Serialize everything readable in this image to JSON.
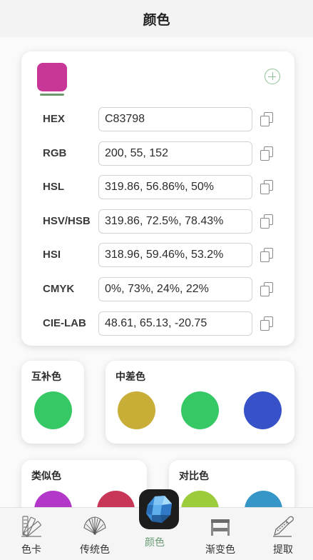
{
  "header": {
    "title": "颜色"
  },
  "current_color": {
    "hex": "#C83798"
  },
  "formats": [
    {
      "label": "HEX",
      "value": "C83798"
    },
    {
      "label": "RGB",
      "value": "200, 55, 152"
    },
    {
      "label": "HSL",
      "value": "319.86, 56.86%, 50%"
    },
    {
      "label": "HSV/HSB",
      "value": "319.86, 72.5%, 78.43%"
    },
    {
      "label": "HSI",
      "value": "318.96, 59.46%, 53.2%"
    },
    {
      "label": "CMYK",
      "value": "0%, 73%, 24%, 22%"
    },
    {
      "label": "CIE-LAB",
      "value": "48.61, 65.13, -20.75"
    }
  ],
  "complementary": {
    "title": "互补色",
    "colors": [
      "#37c866"
    ]
  },
  "middle_diff": {
    "title": "中差色",
    "colors": [
      "#c8ad37",
      "#37c866",
      "#3751c8"
    ]
  },
  "analogous": {
    "title": "类似色",
    "colors": [
      "#b337c8",
      "#c83757"
    ]
  },
  "contrast": {
    "title": "对比色",
    "colors": [
      "#9ccb3b",
      "#3796c8"
    ]
  },
  "tabs": [
    {
      "label": "色卡",
      "icon": "color-card-icon"
    },
    {
      "label": "传统色",
      "icon": "fan-icon"
    },
    {
      "label": "颜色",
      "icon": "gem-icon",
      "active": true
    },
    {
      "label": "渐变色",
      "icon": "gradient-icon"
    },
    {
      "label": "提取",
      "icon": "eyedropper-icon"
    }
  ],
  "colors": {
    "accent": "#6a9a74",
    "add_icon": "#8fbf94"
  }
}
